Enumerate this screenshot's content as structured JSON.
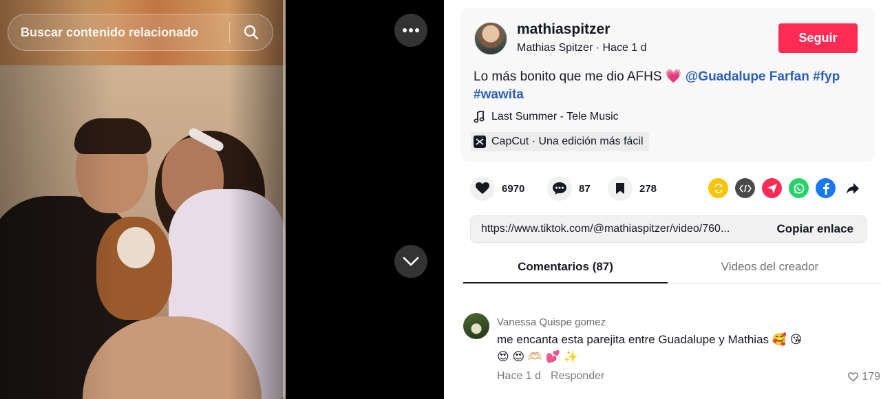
{
  "search": {
    "placeholder": "Buscar contenido relacionado"
  },
  "post": {
    "username": "mathiaspitzer",
    "display_name": "Mathias Spitzer",
    "time": "Hace 1 d",
    "follow_label": "Seguir",
    "caption_text": "Lo más bonito que me dio AFHS",
    "caption_emoji": "💗",
    "mention": "@Guadalupe Farfan",
    "hashtags": [
      "#fyp",
      "#wawita"
    ],
    "music": "Last Summer - Tele Music",
    "capcut_text": "CapCut · Una edición más fácil"
  },
  "stats": {
    "likes": "6970",
    "comments": "87",
    "saves": "278"
  },
  "share_icons": [
    "repost-icon",
    "embed-icon",
    "send-icon",
    "whatsapp-icon",
    "facebook-icon",
    "share-arrow-icon"
  ],
  "colors": {
    "follow": "#fe2c55",
    "repost": "#f8c400",
    "embed": "#4a4a4a",
    "send": "#fe2c55",
    "whatsapp": "#25d366",
    "facebook": "#1877f2",
    "hashtag": "#2b5db9"
  },
  "link": {
    "url": "https://www.tiktok.com/@mathiaspitzer/video/760...",
    "copy_label": "Copiar enlace"
  },
  "tabs": [
    {
      "label": "Comentarios (87)"
    },
    {
      "label": "Videos del creador"
    }
  ],
  "comments": [
    {
      "author": "Vanessa Quispe gomez",
      "text_line1": "me encanta esta parejita entre Guadalupe y Mathias 🥰 😘",
      "text_line2": "😍 😍 🫶🏻 💕 ✨",
      "time": "Hace 1 d",
      "reply_label": "Responder",
      "likes": "179"
    }
  ]
}
